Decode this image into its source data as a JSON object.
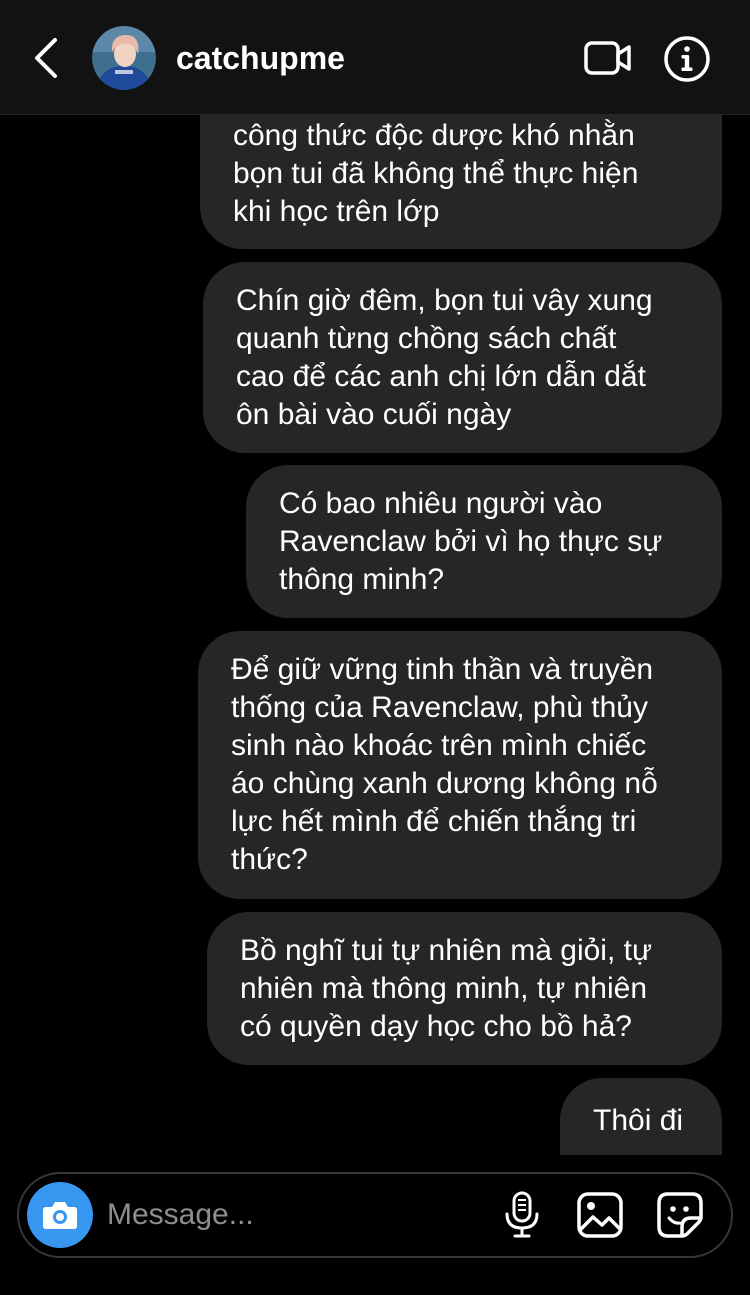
{
  "header": {
    "username": "catchupme"
  },
  "messages": [
    {
      "sender": "other",
      "text": "công thức độc dược khó nhằn\nbọn tui đã không thể thực hiện\nkhi học trên lớp"
    },
    {
      "sender": "other",
      "text": "Chín giờ đêm, bọn tui vây xung\nquanh từng chồng sách chất\ncao để các anh chị lớn dẫn dắt\nôn bài vào cuối ngày"
    },
    {
      "sender": "other",
      "text": "Có bao nhiêu người vào\nRavenclaw bởi vì họ thực sự\nthông minh?"
    },
    {
      "sender": "other",
      "text": "Để giữ vững tinh thần và truyền\nthống của Ravenclaw, phù thủy\nsinh nào khoác trên mình chiếc\náo chùng xanh dương không nỗ\nlực hết mình để chiến thắng tri\nthức?"
    },
    {
      "sender": "other",
      "text": "Bồ nghĩ tui tự nhiên mà giỏi, tự\nnhiên mà thông minh, tự nhiên\ncó quyền dạy học cho bồ hả?"
    },
    {
      "sender": "other",
      "text": "Thôi đi"
    }
  ],
  "composer": {
    "placeholder": "Message..."
  },
  "icons": {
    "back": "chevron-left-icon",
    "video": "video-camera-icon",
    "info": "info-icon",
    "camera": "camera-icon",
    "mic": "microphone-icon",
    "gallery": "image-icon",
    "sticker": "sticker-icon"
  },
  "colors": {
    "background": "#000000",
    "header": "#121212",
    "bubble": "#262626",
    "accent": "#3797f0",
    "placeholder": "#8e8e8e"
  }
}
